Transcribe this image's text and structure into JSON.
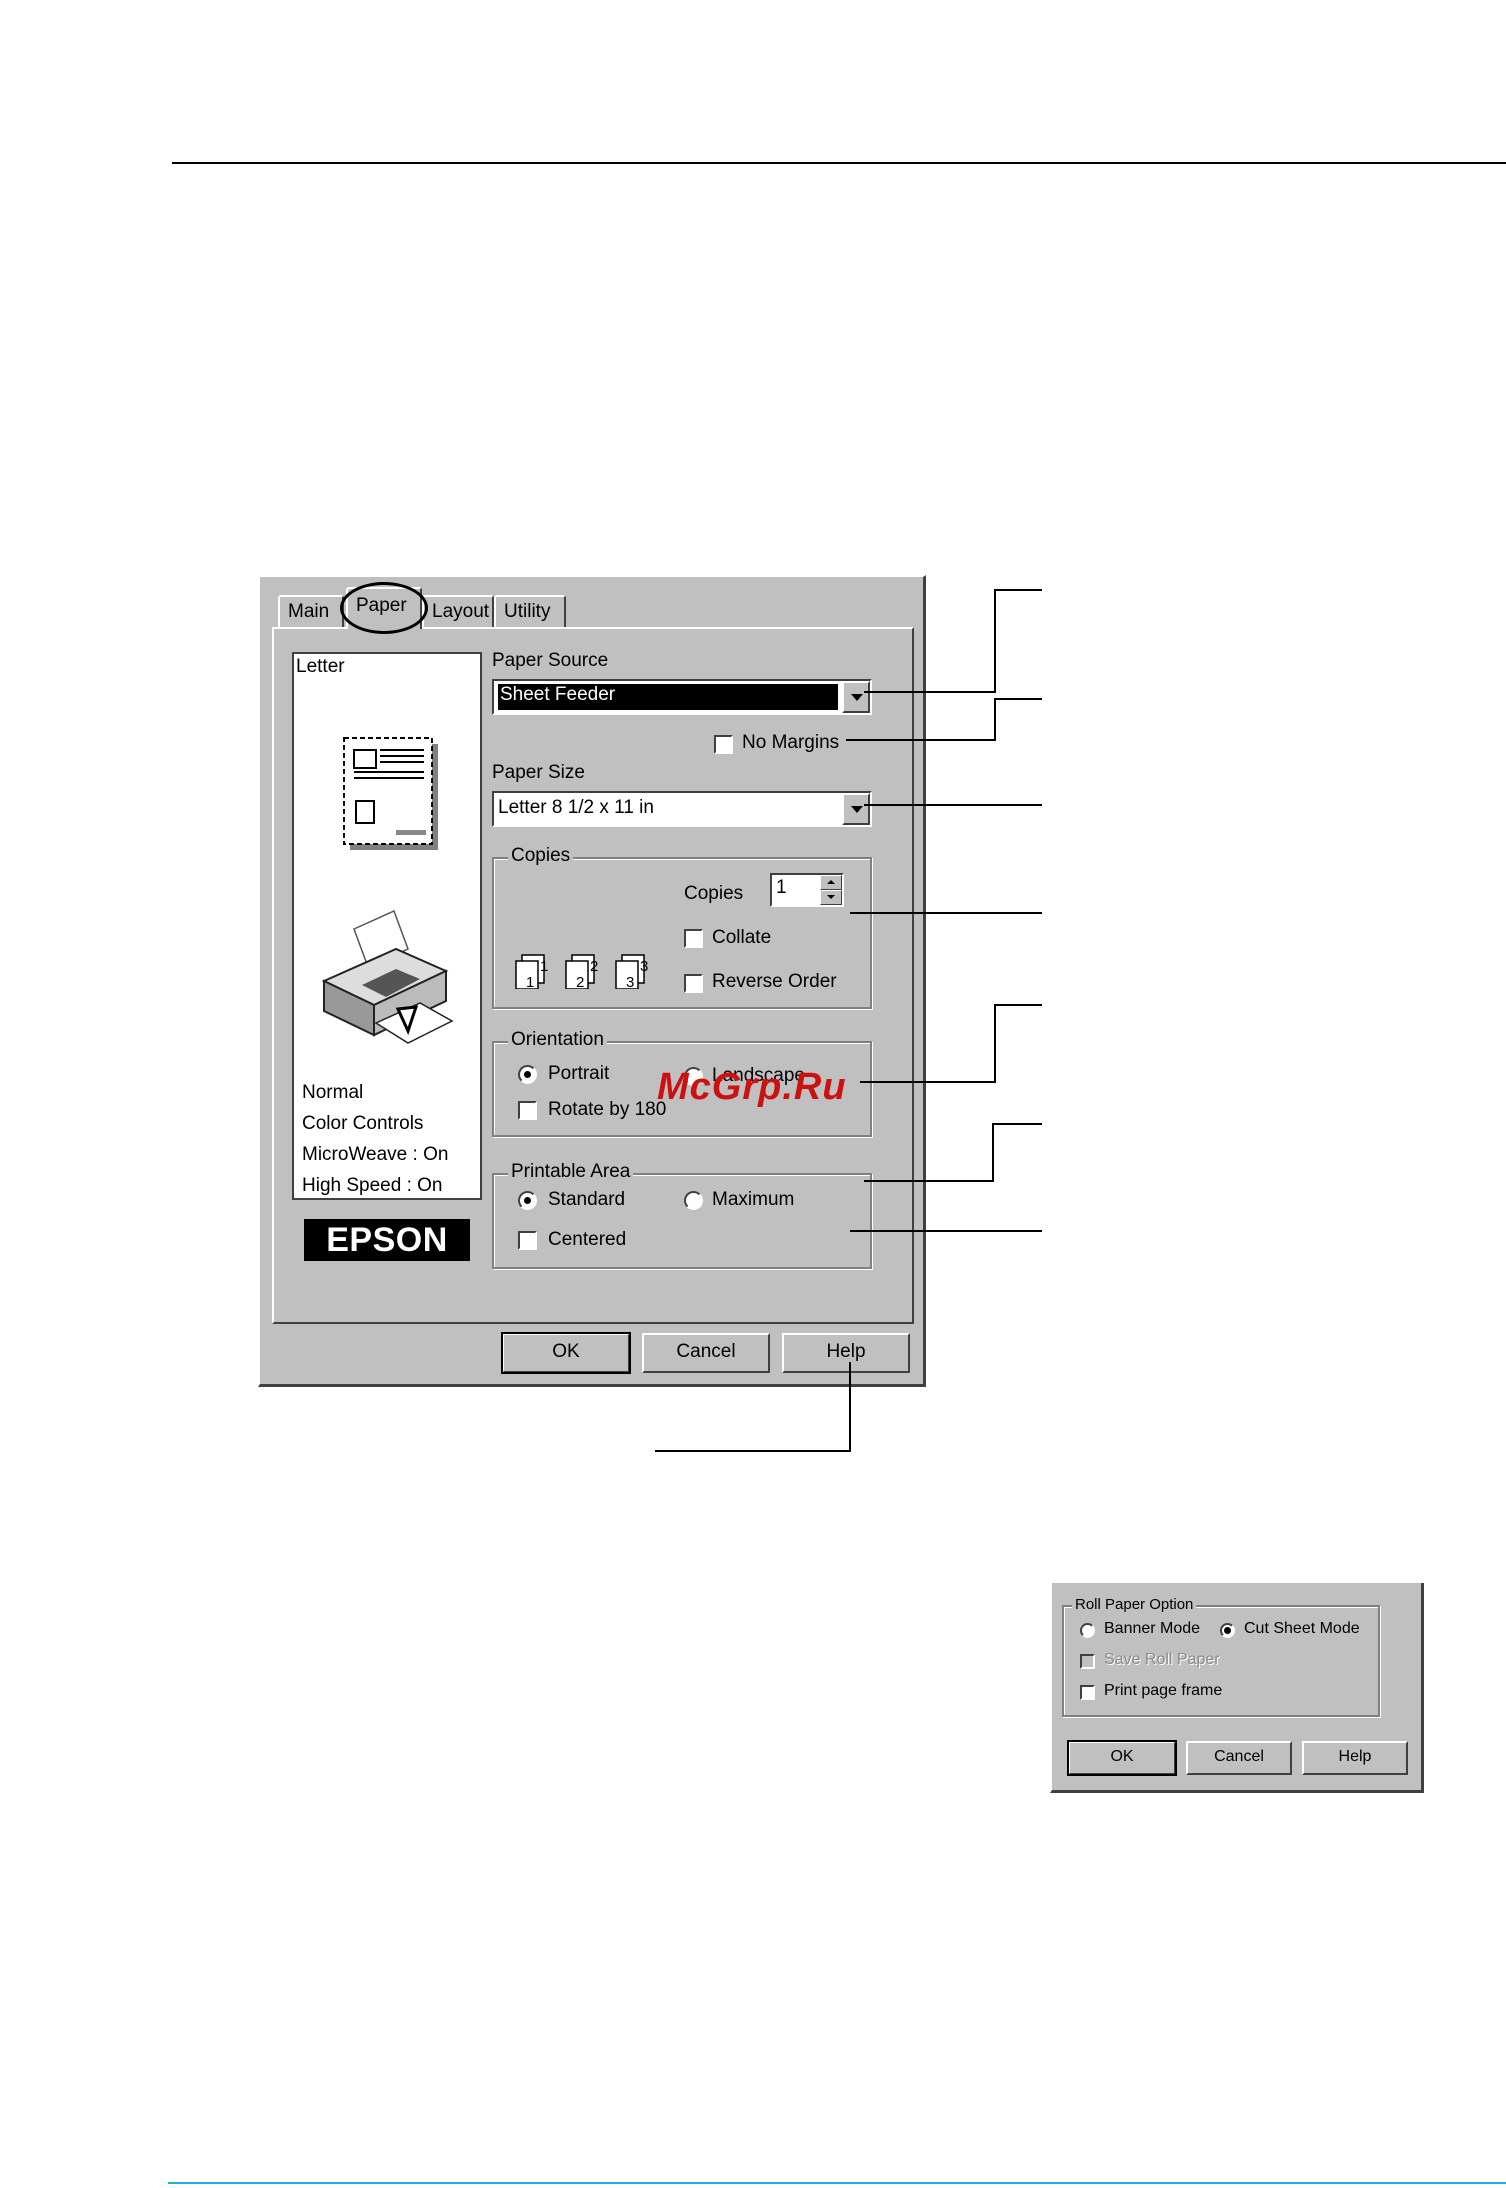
{
  "dialog": {
    "tabs": [
      "Main",
      "Paper",
      "Layout",
      "Utility"
    ],
    "active_tab": "Paper",
    "preview": {
      "paper_name": "Letter",
      "status_lines": [
        "Normal",
        "Color Controls",
        "MicroWeave : On",
        "High Speed : On"
      ],
      "logo": "EPSON"
    },
    "paper_source": {
      "label": "Paper Source",
      "value": "Sheet Feeder"
    },
    "no_margins": {
      "label": "No Margins",
      "checked": false
    },
    "paper_size": {
      "label": "Paper Size",
      "value": "Letter 8 1/2 x 11 in"
    },
    "copies": {
      "group_label": "Copies",
      "count_label": "Copies",
      "count": "1",
      "collate": {
        "label": "Collate",
        "checked": false
      },
      "reverse_order": {
        "label": "Reverse Order",
        "checked": false
      },
      "icons": [
        "copy-stack-1-icon",
        "copy-stack-2-icon",
        "copy-stack-3-icon"
      ]
    },
    "orientation": {
      "group_label": "Orientation",
      "portrait": "Portrait",
      "landscape": "Landscape",
      "selected": "Portrait",
      "rotate": {
        "label": "Rotate by 180",
        "checked": false
      }
    },
    "printable_area": {
      "group_label": "Printable Area",
      "standard": "Standard",
      "maximum": "Maximum",
      "selected": "Standard",
      "centered": {
        "label": "Centered",
        "checked": false
      }
    },
    "buttons": {
      "ok": "OK",
      "cancel": "Cancel",
      "help": "Help"
    }
  },
  "watermark": "McGrp.Ru",
  "roll_paper": {
    "group_label": "Roll Paper Option",
    "banner_mode": "Banner Mode",
    "cut_sheet_mode": "Cut Sheet Mode",
    "selected": "Cut Sheet Mode",
    "save_roll_paper": {
      "label": "Save Roll Paper",
      "enabled": false
    },
    "print_page_frame": {
      "label": "Print page frame",
      "checked": false
    },
    "buttons": {
      "ok": "OK",
      "cancel": "Cancel",
      "help": "Help"
    }
  },
  "colors": {
    "dialog_face": "#c0c0c0",
    "selection": "#000000",
    "watermark": "#cc1111",
    "bottom_rule": "#1ab0d8"
  }
}
